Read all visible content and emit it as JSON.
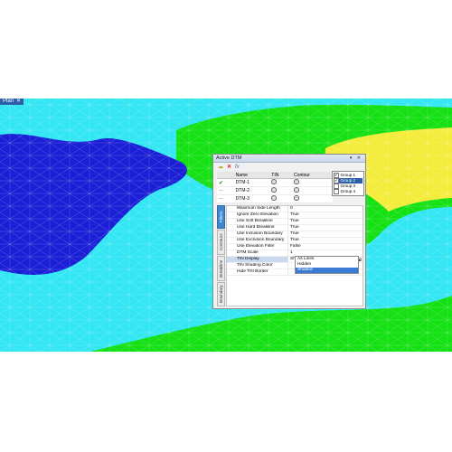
{
  "plan_tab": {
    "label": "Plan",
    "close": "✕"
  },
  "window": {
    "title": "Active DTM",
    "controls": "▾ ✕"
  },
  "toolbar": {
    "icons": [
      "cloud-icon",
      "delete-icon",
      "function-icon"
    ],
    "fx_label": "fx"
  },
  "dtm_table": {
    "headers": [
      "",
      "Name",
      "TIN",
      "Contour"
    ],
    "rows": [
      {
        "name": "DTM-1",
        "active": true
      },
      {
        "name": "DTM-2",
        "active": false
      },
      {
        "name": "DTM-3",
        "active": false
      }
    ]
  },
  "groups": [
    {
      "label": "Group 1",
      "checked": true,
      "selected": false
    },
    {
      "label": "Group 2",
      "checked": true,
      "selected": true
    },
    {
      "label": "Group 3",
      "checked": false,
      "selected": false
    },
    {
      "label": "Group 4",
      "checked": false,
      "selected": false
    }
  ],
  "side_tabs": [
    "Filters",
    "Contours",
    "Breakline",
    "Boundary"
  ],
  "properties": [
    {
      "name": "Maximum Side Length",
      "value": "0"
    },
    {
      "name": "Ignore Zero Elevation",
      "value": "True"
    },
    {
      "name": "Use Soft Breakline",
      "value": "True"
    },
    {
      "name": "Use Hard Breakline",
      "value": "True"
    },
    {
      "name": "Use Inclusion Boundary",
      "value": "True"
    },
    {
      "name": "Use Exclusion Boundary",
      "value": "True"
    },
    {
      "name": "Use Elevation Filter",
      "value": "False"
    },
    {
      "name": "DTM Scale",
      "value": "1"
    },
    {
      "name": "TIN Display",
      "value": "Shaded"
    },
    {
      "name": "TIN Shading Color",
      "value": ""
    },
    {
      "name": "Hide TIN Border",
      "value": ""
    }
  ],
  "dropdown_options": [
    "As Lines",
    "Hidden",
    "Shaded"
  ],
  "dropdown_selected": "Shaded",
  "colors": {
    "water": "#33e6f3",
    "lake": "#1b1fd6",
    "land": "#14e014",
    "high": "#f4ec3a",
    "accent": "#2c5fa8"
  }
}
